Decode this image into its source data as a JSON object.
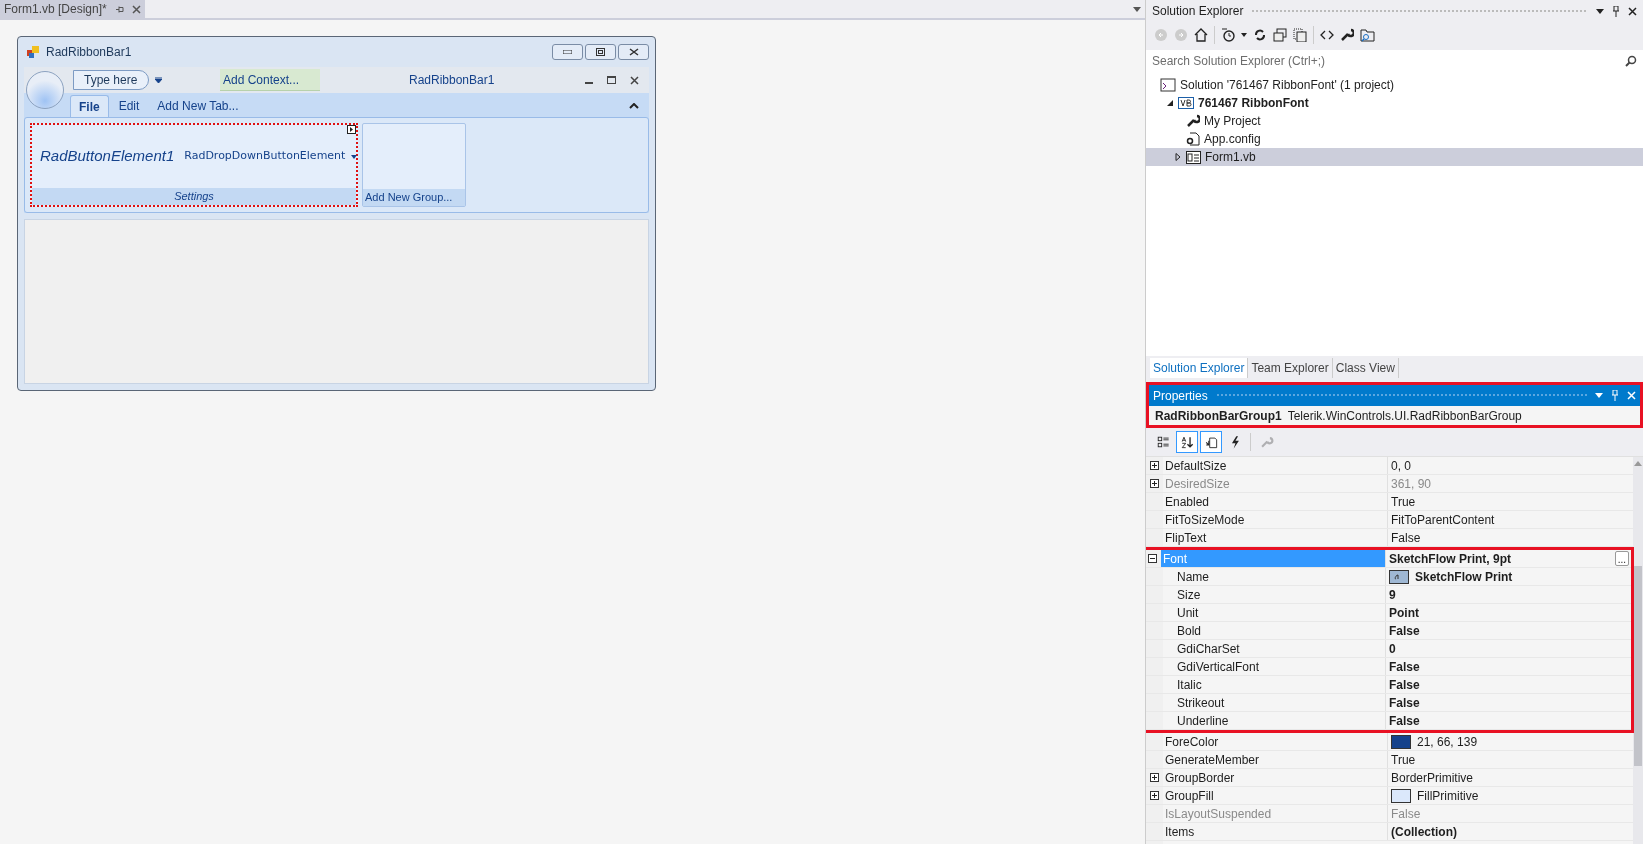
{
  "document_tab": {
    "title": "Form1.vb [Design]*",
    "selected": true
  },
  "designer": {
    "window_title": "RadRibbonBar1",
    "quick_access_placeholder": "Type here",
    "context_button": "Add Context...",
    "ribbon_caption": "RadRibbonBar1",
    "tabs": [
      {
        "label": "File",
        "selected": true
      },
      {
        "label": "Edit",
        "selected": false
      },
      {
        "label": "Add New Tab...",
        "selected": false
      }
    ],
    "groups": [
      {
        "caption": "Settings",
        "selected": true,
        "elements": [
          {
            "kind": "button",
            "label": "RadButtonElement1"
          },
          {
            "kind": "dropdown",
            "label": "RadDropDownButtonElement"
          }
        ]
      },
      {
        "caption": "Add New Group...",
        "selected": false
      }
    ]
  },
  "solution_explorer": {
    "title": "Solution Explorer",
    "search_placeholder": "Search Solution Explorer (Ctrl+;)",
    "tree": [
      {
        "kind": "solution",
        "label": "Solution '761467 RibbonFont' (1 project)",
        "bold": false,
        "selected": false,
        "children": [
          {
            "kind": "project",
            "label": "761467 RibbonFont",
            "bold": true,
            "selected": false,
            "expanded": true,
            "children": [
              {
                "kind": "wrench",
                "label": "My Project",
                "bold": false,
                "selected": false
              },
              {
                "kind": "config",
                "label": "App.config",
                "bold": false,
                "selected": false
              },
              {
                "kind": "form",
                "label": "Form1.vb",
                "bold": false,
                "selected": true,
                "expanded": false
              }
            ]
          }
        ]
      }
    ],
    "tabs": [
      {
        "label": "Solution Explorer",
        "selected": true
      },
      {
        "label": "Team Explorer",
        "selected": false
      },
      {
        "label": "Class View",
        "selected": false
      }
    ]
  },
  "properties": {
    "title": "Properties",
    "highlighted": true,
    "object_name": "RadRibbonBarGroup1",
    "object_type": "Telerik.WinControls.UI.RadRibbonBarGroup",
    "toolbar": [
      {
        "kind": "categorized",
        "selected": false,
        "disabled": false
      },
      {
        "kind": "alphabetical",
        "selected": true,
        "disabled": false
      },
      {
        "kind": "property-pages",
        "selected": true,
        "disabled": false
      },
      {
        "kind": "events",
        "selected": false,
        "disabled": false
      },
      {
        "kind": "wrench",
        "selected": false,
        "disabled": true
      }
    ],
    "rows": [
      {
        "name": "DefaultSize",
        "value": "0, 0",
        "expanded": false,
        "disabled": false,
        "selected": false,
        "bold": false
      },
      {
        "name": "DesiredSize",
        "value": "361, 90",
        "expanded": false,
        "disabled": true,
        "selected": false,
        "bold": false
      },
      {
        "name": "Enabled",
        "value": "True",
        "disabled": false,
        "selected": false,
        "bold": false
      },
      {
        "name": "FitToSizeMode",
        "value": "FitToParentContent",
        "disabled": false,
        "selected": false,
        "bold": false
      },
      {
        "name": "FlipText",
        "value": "False",
        "disabled": false,
        "selected": false,
        "bold": false
      },
      {
        "name": "Font",
        "value": "SketchFlow Print, 9pt",
        "expanded": true,
        "disabled": false,
        "selected": true,
        "bold": true,
        "highlighted": true,
        "button": "...",
        "children": [
          {
            "name": "Name",
            "value": "SketchFlow Print",
            "preview": true,
            "bold": true
          },
          {
            "name": "Size",
            "value": "9",
            "bold": true
          },
          {
            "name": "Unit",
            "value": "Point",
            "bold": true
          },
          {
            "name": "Bold",
            "value": "False",
            "bold": true
          },
          {
            "name": "GdiCharSet",
            "value": "0",
            "bold": true
          },
          {
            "name": "GdiVerticalFont",
            "value": "False",
            "bold": true
          },
          {
            "name": "Italic",
            "value": "False",
            "bold": true
          },
          {
            "name": "Strikeout",
            "value": "False",
            "bold": true
          },
          {
            "name": "Underline",
            "value": "False",
            "bold": true
          }
        ]
      },
      {
        "name": "ForeColor",
        "value": "21, 66, 139",
        "color": "#15428b",
        "disabled": false,
        "selected": false,
        "bold": false
      },
      {
        "name": "GenerateMember",
        "value": "True",
        "disabled": false,
        "selected": false,
        "bold": false
      },
      {
        "name": "GroupBorder",
        "value": "BorderPrimitive",
        "expanded": false,
        "disabled": false,
        "selected": false,
        "bold": false
      },
      {
        "name": "GroupFill",
        "value": "FillPrimitive",
        "color": "#dbe8fb",
        "expanded": false,
        "disabled": false,
        "selected": false,
        "bold": false
      },
      {
        "name": "IsLayoutSuspended",
        "value": "False",
        "disabled": true,
        "selected": false,
        "bold": false
      },
      {
        "name": "Items",
        "value": "(Collection)",
        "disabled": false,
        "selected": false,
        "bold": true
      }
    ]
  }
}
